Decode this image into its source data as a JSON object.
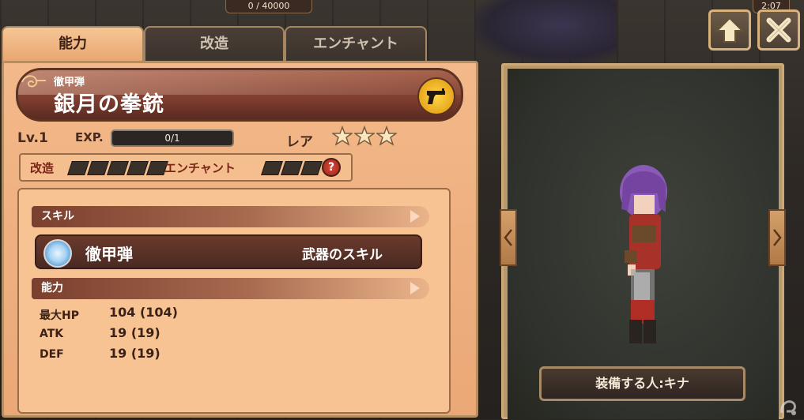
{
  "top_counter": "0 / 40000",
  "time": "2:07",
  "tabs": [
    {
      "label": "能力",
      "active": true
    },
    {
      "label": "改造",
      "active": false
    },
    {
      "label": "エンチャント",
      "active": false
    }
  ],
  "item": {
    "subtitle": "徹甲弾",
    "name": "銀月の拳銃",
    "icon": "pistol-icon"
  },
  "level": "Lv.1",
  "exp_label": "EXP.",
  "exp_value": "0/1",
  "rarity_label": "レア",
  "rarity_stars": 3,
  "enhance": {
    "kaizo_label": "改造",
    "kaizo_pips": 5,
    "enchant_label": "エンチャント",
    "enchant_pips": 3,
    "help_glyph": "?"
  },
  "skill_section": {
    "header": "スキル",
    "skill_name": "徹甲弾",
    "skill_type": "武器のスキル"
  },
  "ability_section": {
    "header": "能力",
    "stats": [
      {
        "label": "最大HP",
        "value": "104 (104)"
      },
      {
        "label": "ATK",
        "value": "19 (19)"
      },
      {
        "label": "DEF",
        "value": "19 (19)"
      }
    ]
  },
  "equip_button": "装備する人:キナ",
  "colors": {
    "panel": "#eeae7e",
    "banner": "#7d3d2f",
    "accent_gold": "#e8a81c"
  }
}
